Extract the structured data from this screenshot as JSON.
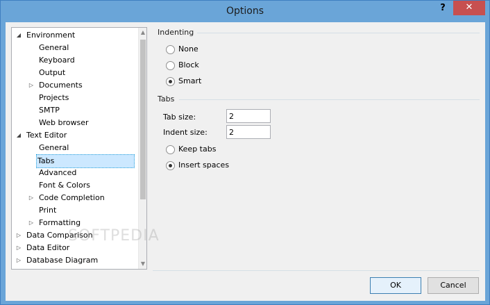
{
  "window": {
    "title": "Options",
    "help_label": "?",
    "close_label": "✕"
  },
  "tree": {
    "items": [
      {
        "label": "Environment",
        "expanded": true
      },
      {
        "label": "General"
      },
      {
        "label": "Keyboard"
      },
      {
        "label": "Output"
      },
      {
        "label": "Documents",
        "expandable": true
      },
      {
        "label": "Projects"
      },
      {
        "label": "SMTP"
      },
      {
        "label": "Web browser"
      },
      {
        "label": "Text Editor",
        "expanded": true
      },
      {
        "label": "General"
      },
      {
        "label": "Tabs",
        "selected": true
      },
      {
        "label": "Advanced"
      },
      {
        "label": "Font & Colors"
      },
      {
        "label": "Code Completion",
        "expandable": true
      },
      {
        "label": "Print"
      },
      {
        "label": "Formatting",
        "expandable": true
      },
      {
        "label": "Data Comparison",
        "expandable": true
      },
      {
        "label": "Data Editor",
        "expandable": true
      },
      {
        "label": "Database Diagram",
        "expandable": true
      }
    ]
  },
  "indenting": {
    "label": "Indenting",
    "options": [
      {
        "label": "None",
        "checked": false
      },
      {
        "label": "Block",
        "checked": false
      },
      {
        "label": "Smart",
        "checked": true
      }
    ]
  },
  "tabs": {
    "label": "Tabs",
    "tab_size_label": "Tab size:",
    "tab_size_value": "2",
    "indent_size_label": "Indent size:",
    "indent_size_value": "2",
    "options": [
      {
        "label": "Keep tabs",
        "checked": false
      },
      {
        "label": "Insert spaces",
        "checked": true
      }
    ]
  },
  "footer": {
    "ok_label": "OK",
    "cancel_label": "Cancel"
  },
  "watermark": "SOFTPEDIA"
}
